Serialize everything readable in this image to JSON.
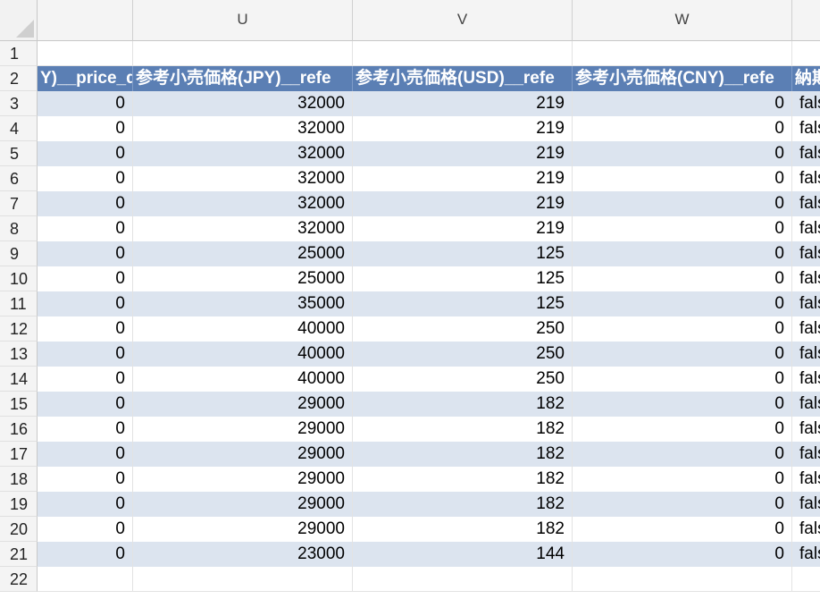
{
  "sheet": {
    "columns": [
      {
        "label": ""
      },
      {
        "label": "U"
      },
      {
        "label": "V"
      },
      {
        "label": "W"
      },
      {
        "label": ""
      }
    ],
    "rows": [
      {
        "num": "1",
        "cells": [
          "",
          "",
          "",
          "",
          ""
        ]
      },
      {
        "num": "2",
        "header": true,
        "cells": [
          "Y)__price_d",
          "参考小売価格(JPY)__refe",
          "参考小売価格(USD)__refe",
          "参考小売価格(CNY)__refe",
          "納期"
        ]
      },
      {
        "num": "3",
        "cells": [
          "0",
          "32000",
          "219",
          "0",
          "fals"
        ]
      },
      {
        "num": "4",
        "cells": [
          "0",
          "32000",
          "219",
          "0",
          "fals"
        ]
      },
      {
        "num": "5",
        "cells": [
          "0",
          "32000",
          "219",
          "0",
          "fals"
        ]
      },
      {
        "num": "6",
        "cells": [
          "0",
          "32000",
          "219",
          "0",
          "fals"
        ]
      },
      {
        "num": "7",
        "cells": [
          "0",
          "32000",
          "219",
          "0",
          "fals"
        ]
      },
      {
        "num": "8",
        "cells": [
          "0",
          "32000",
          "219",
          "0",
          "fals"
        ]
      },
      {
        "num": "9",
        "cells": [
          "0",
          "25000",
          "125",
          "0",
          "fals"
        ]
      },
      {
        "num": "10",
        "cells": [
          "0",
          "25000",
          "125",
          "0",
          "fals"
        ]
      },
      {
        "num": "11",
        "cells": [
          "0",
          "35000",
          "125",
          "0",
          "fals"
        ]
      },
      {
        "num": "12",
        "cells": [
          "0",
          "40000",
          "250",
          "0",
          "fals"
        ]
      },
      {
        "num": "13",
        "cells": [
          "0",
          "40000",
          "250",
          "0",
          "fals"
        ]
      },
      {
        "num": "14",
        "cells": [
          "0",
          "40000",
          "250",
          "0",
          "fals"
        ]
      },
      {
        "num": "15",
        "cells": [
          "0",
          "29000",
          "182",
          "0",
          "fals"
        ]
      },
      {
        "num": "16",
        "cells": [
          "0",
          "29000",
          "182",
          "0",
          "fals"
        ]
      },
      {
        "num": "17",
        "cells": [
          "0",
          "29000",
          "182",
          "0",
          "fals"
        ]
      },
      {
        "num": "18",
        "cells": [
          "0",
          "29000",
          "182",
          "0",
          "fals"
        ]
      },
      {
        "num": "19",
        "cells": [
          "0",
          "29000",
          "182",
          "0",
          "fals"
        ]
      },
      {
        "num": "20",
        "cells": [
          "0",
          "29000",
          "182",
          "0",
          "fals"
        ]
      },
      {
        "num": "21",
        "cells": [
          "0",
          "23000",
          "144",
          "0",
          "fals"
        ]
      },
      {
        "num": "22",
        "cells": [
          "",
          "",
          "",
          "",
          ""
        ]
      }
    ]
  },
  "colors": {
    "header_fill": "#5b7fb4",
    "band_fill": "#dce4ef",
    "header_text": "#ffffff"
  }
}
